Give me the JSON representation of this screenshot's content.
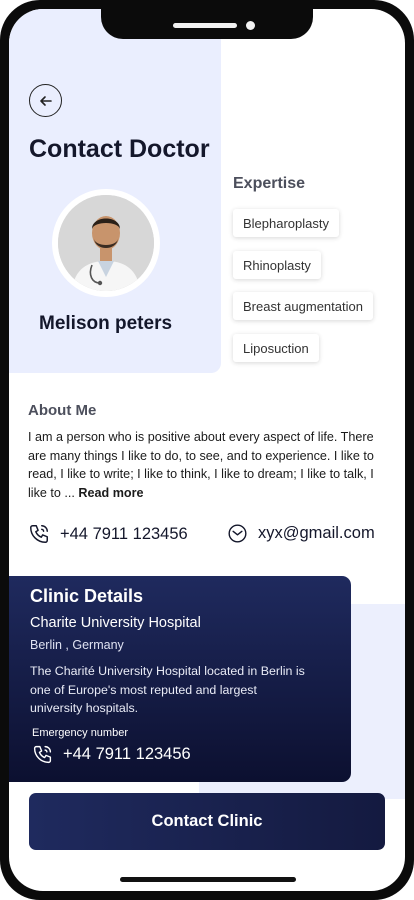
{
  "header": {
    "title": "Contact Doctor",
    "back_icon": "arrow-left-icon"
  },
  "doctor": {
    "name": "Melison peters"
  },
  "expertise": {
    "title": "Expertise",
    "items": [
      "Blepharoplasty",
      "Rhinoplasty",
      "Breast augmentation",
      "Liposuction"
    ]
  },
  "about": {
    "title": "About Me",
    "text": "I am a person who is positive about every aspect of life. There are many things I like to do, to see, and to experience. I like to read, I like to write; I like to think, I like to dream; I like to talk, I like to ... ",
    "read_more": "Read more"
  },
  "contact": {
    "phone": "+44 7911 123456",
    "email": "xyx@gmail.com",
    "phone_icon": "phone-icon",
    "email_icon": "mail-icon"
  },
  "clinic": {
    "title": "Clinic Details",
    "name": "Charite University Hospital",
    "location": "Berlin , Germany",
    "description": "The Charité University Hospital located in Berlin is one of Europe's most reputed and largest university hospitals.",
    "emergency_label": "Emergency number",
    "emergency_phone": "+44 7911 123456"
  },
  "cta": {
    "label": "Contact Clinic"
  },
  "colors": {
    "accent_navy": "#1f2a5e",
    "panel_bg": "#eaeefe",
    "text_dark": "#14172b"
  }
}
